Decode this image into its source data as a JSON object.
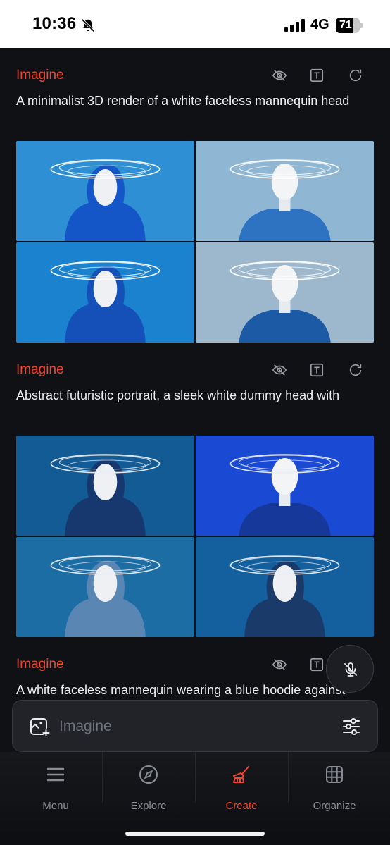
{
  "status_bar": {
    "time": "10:36",
    "network": "4G",
    "battery_level": "71",
    "battery_fraction": 0.71,
    "icons": [
      "bell-slash-icon",
      "signal-icon"
    ]
  },
  "feed": [
    {
      "type_label": "Imagine",
      "prompt": "A minimalist 3D render of a white faceless mannequin head",
      "images": [
        {
          "bg": "#2f8fd4",
          "hood": "#1455c8",
          "ring": "#ffffff",
          "style": "hood"
        },
        {
          "bg": "#8fb6d2",
          "hood": "#2e72c2",
          "ring": "#ffffff",
          "style": "neck"
        },
        {
          "bg": "#1a82cf",
          "hood": "#1450b8",
          "ring": "#ffffff",
          "style": "hood"
        },
        {
          "bg": "#9db8cd",
          "hood": "#1d5aa6",
          "ring": "#ffffff",
          "style": "neck"
        }
      ]
    },
    {
      "type_label": "Imagine",
      "prompt": "Abstract futuristic portrait, a sleek white dummy head with",
      "images": [
        {
          "bg": "#135b94",
          "hood": "#16386e",
          "ring": "#e9eef5",
          "style": "hood"
        },
        {
          "bg": "#1a49d4",
          "hood": "#16389a",
          "ring": "#e9eef5",
          "style": "neck"
        },
        {
          "bg": "#1c6da4",
          "hood": "#5a86b4",
          "ring": "#e9eef5",
          "style": "hood"
        },
        {
          "bg": "#14609e",
          "hood": "#1a3a6a",
          "ring": "#e9eef5",
          "style": "hood"
        }
      ]
    },
    {
      "type_label": "Imagine",
      "prompt": "A white faceless mannequin wearing a blue hoodie against",
      "images": []
    }
  ],
  "composer": {
    "placeholder": "Imagine",
    "value": ""
  },
  "nav": [
    {
      "label": "Menu",
      "icon": "menu-icon",
      "active": false
    },
    {
      "label": "Explore",
      "icon": "compass-icon",
      "active": false
    },
    {
      "label": "Create",
      "icon": "brush-icon",
      "active": true
    },
    {
      "label": "Organize",
      "icon": "grid-icon",
      "active": false
    }
  ],
  "colors": {
    "accent": "#f0462f",
    "background": "#0f1115",
    "nav_inactive": "#8a8d95"
  }
}
